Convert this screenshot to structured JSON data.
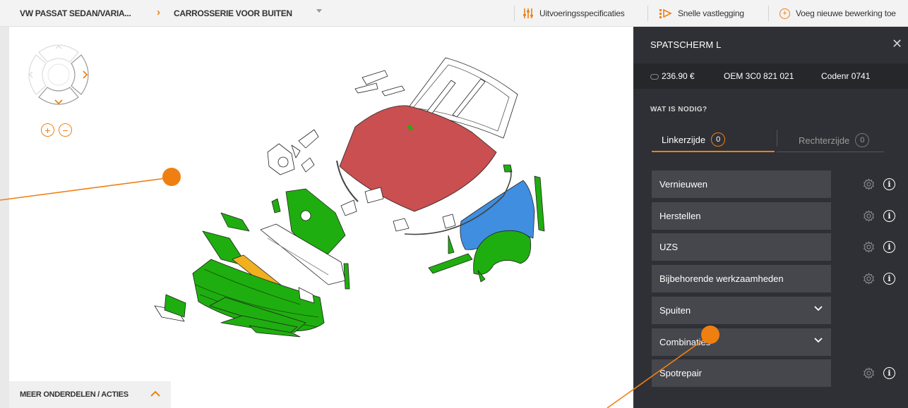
{
  "topbar": {
    "breadcrumb_vehicle": "VW PASSAT SEDAN/VARIA...",
    "breadcrumb_section": "CARROSSERIE VOOR BUITEN",
    "action_specs": "Uitvoeringsspecificaties",
    "action_quick": "Snelle vastlegging",
    "action_add": "Voeg nieuwe bewerking toe"
  },
  "canvas": {
    "bottom_bar_label": "MEER ONDERDELEN / ACTIES"
  },
  "panel": {
    "title": "SPATSCHERM L",
    "price": "236.90 €",
    "oem": "OEM 3C0 821 021",
    "code": "Codenr 0741",
    "section_label": "WAT IS NODIG?",
    "tabs": [
      {
        "label": "Linkerzijde",
        "count": "0"
      },
      {
        "label": "Rechterzijde",
        "count": "0"
      }
    ],
    "rows": [
      {
        "label": "Vernieuwen"
      },
      {
        "label": "Herstellen"
      },
      {
        "label": "UZS"
      },
      {
        "label": "Bijbehorende werkzaamheden"
      },
      {
        "label": "Spuiten"
      },
      {
        "label": "Combinaties"
      },
      {
        "label": "Spotrepair"
      }
    ]
  },
  "colors": {
    "accent": "#f07f12",
    "panel_bg": "#2f3035",
    "row_bg": "#45474d",
    "part_green": "#1fae0f",
    "part_red": "#c94f50",
    "part_blue": "#3f8ee0",
    "part_yellow": "#f0b020"
  }
}
